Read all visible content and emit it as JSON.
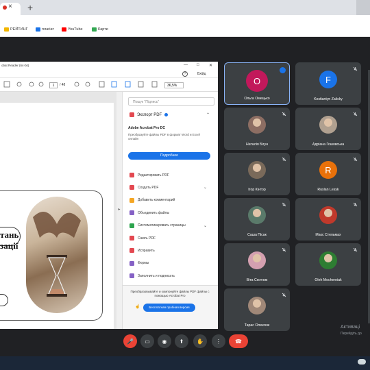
{
  "browser": {
    "tab_close": "×",
    "new_tab": "+",
    "bookmarks": [
      {
        "label": "РЕЙТИНГ",
        "color": "#f2b600"
      },
      {
        "label": "плагіат",
        "color": "#1a73e8"
      },
      {
        "label": "YouTube",
        "color": "#ff0000"
      },
      {
        "label": "Карти",
        "color": "#34a853"
      }
    ]
  },
  "pdf": {
    "window_title": "obat Reader (64-bit)",
    "win_controls": [
      "—",
      "□",
      "✕"
    ],
    "signin": "Вхійд",
    "page_current": "1",
    "page_total": "/ 48",
    "zoom": "36,5%",
    "slide_text_1": "тань",
    "slide_text_2": "зації",
    "sidebar": {
      "search_placeholder": "Пошук \"Підпись\"",
      "export_title": "Экспорт PDF",
      "product": "Adobe Acrobat Pro DC",
      "desc": "Преобразуйте файлы PDF в формат Word и Excel онлайн",
      "more_button": "Подробнее",
      "tools": [
        {
          "label": "Редактировать PDF",
          "color": "#e34850"
        },
        {
          "label": "Создать PDF",
          "color": "#e34850",
          "chevron": true
        },
        {
          "label": "Добавить комментарий",
          "color": "#f5a623"
        },
        {
          "label": "Объединить файлы",
          "color": "#8561c5"
        },
        {
          "label": "Систематизировать страницы",
          "color": "#2da44e",
          "chevron": true
        },
        {
          "label": "Сжать PDF",
          "color": "#e34850"
        },
        {
          "label": "Исправить",
          "color": "#e34850"
        },
        {
          "label": "Формы",
          "color": "#8561c5"
        },
        {
          "label": "Заполнить и подписать",
          "color": "#8561c5"
        }
      ],
      "promo": "Преобразовывайте и компонуйте файлы PDF файлы с помощью Acrobat Pro",
      "trial_button": "Бесплатная пробная версия"
    }
  },
  "participants": [
    {
      "name": "Ольга Омецько",
      "initial": "О",
      "color": "#c2185b",
      "kind": "letter",
      "active": true
    },
    {
      "name": "Kostiantyn Zalisky",
      "initial": "F",
      "color": "#1a73e8",
      "kind": "letter"
    },
    {
      "name": "Наталія Бігун",
      "kind": "photo",
      "color": "#8d6e63"
    },
    {
      "name": "Адріана Гошовська",
      "kind": "photo",
      "color": "#b0a090"
    },
    {
      "name": "Ігор Кінтор",
      "kind": "photo",
      "color": "#7a6a5a"
    },
    {
      "name": "Ruslan Lesyk",
      "initial": "R",
      "color": "#e8710a",
      "kind": "letter"
    },
    {
      "name": "Саша Пісак",
      "kind": "photo",
      "color": "#5a7a6a"
    },
    {
      "name": "Макс Стельмах",
      "kind": "photo",
      "color": "#c0392b"
    },
    {
      "name": "Віта Скотник",
      "kind": "photo",
      "color": "#d4a0b0"
    },
    {
      "name": "Oleh Mocherniak",
      "kind": "photo",
      "color": "#2e7d32"
    },
    {
      "name": "Тарас Олексюк",
      "kind": "photo",
      "color": "#a08878"
    }
  ],
  "watermark": {
    "line1": "Активаці",
    "line2": "Перейдіть до"
  },
  "controls": {
    "mic": "🎤",
    "cam": "▭",
    "cc": "◉",
    "present": "⬆",
    "hand": "✋",
    "more": "⋮",
    "end": "☎"
  },
  "colors": {
    "end_red": "#ea4335",
    "accent_blue": "#1a73e8"
  }
}
